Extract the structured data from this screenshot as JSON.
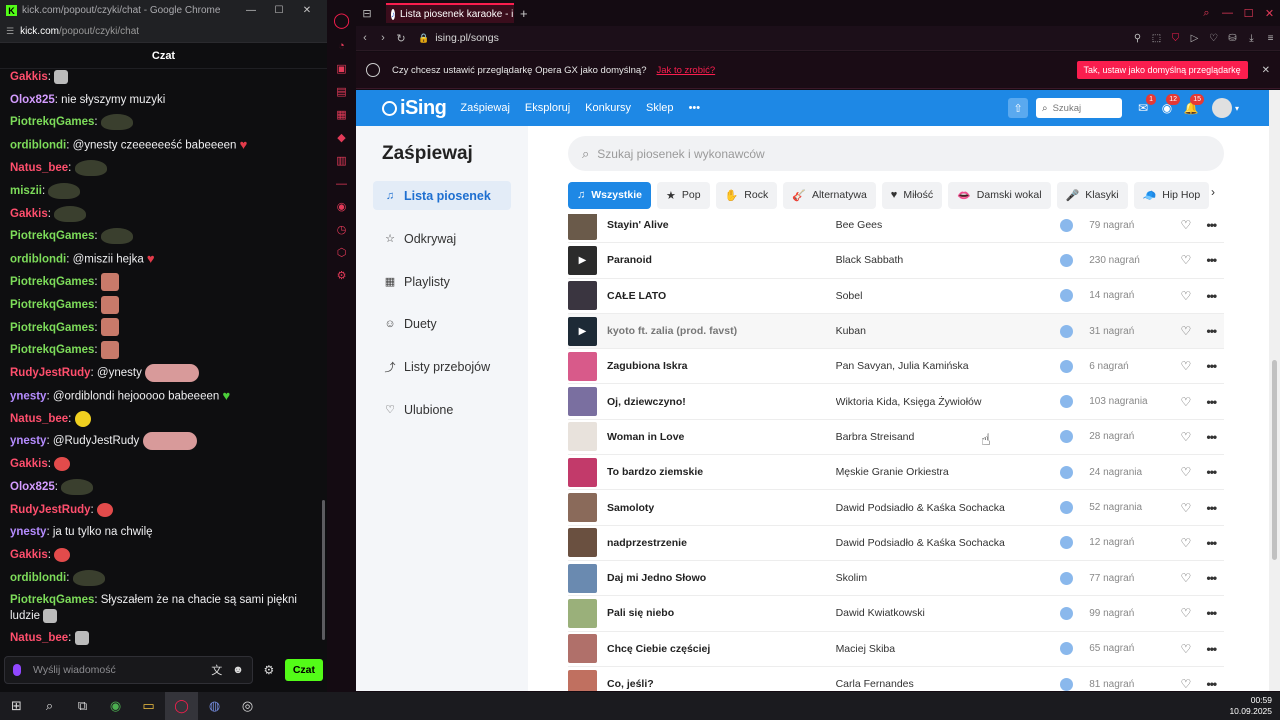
{
  "chat_window": {
    "title": "kick.com/popout/czyki/chat - Google Chrome",
    "url_host": "kick.com",
    "url_path": "/popout/czyki/chat",
    "header": "Czat",
    "input_placeholder": "Wyślij wiadomość",
    "send_label": "Czat",
    "messages": [
      {
        "user": "Gakkis",
        "color": "#ff4f6d",
        "text": "",
        "emote": "small"
      },
      {
        "user": "Olox825",
        "color": "#d49cff",
        "text": "nie słyszymy muzyki",
        "emote": ""
      },
      {
        "user": "PiotrekqGames",
        "color": "#7ddc5a",
        "text": "",
        "emote": "frog"
      },
      {
        "user": "ordiblondi",
        "color": "#7ddc5a",
        "text": "@ynesty czeeeeeeść babeeeen",
        "emote": "heart-red"
      },
      {
        "user": "Natus_bee",
        "color": "#ff4f6d",
        "text": "",
        "emote": "frog"
      },
      {
        "user": "miszii",
        "color": "#7ddc5a",
        "text": "",
        "emote": "frog"
      },
      {
        "user": "Gakkis",
        "color": "#ff4f6d",
        "text": "",
        "emote": "frog"
      },
      {
        "user": "PiotrekqGames",
        "color": "#7ddc5a",
        "text": "",
        "emote": "frog"
      },
      {
        "user": "ordiblondi",
        "color": "#7ddc5a",
        "text": "@miszii hejka",
        "emote": "heart-red"
      },
      {
        "user": "PiotrekqGames",
        "color": "#7ddc5a",
        "text": "",
        "emote": "face"
      },
      {
        "user": "PiotrekqGames",
        "color": "#7ddc5a",
        "text": "",
        "emote": "face"
      },
      {
        "user": "PiotrekqGames",
        "color": "#7ddc5a",
        "text": "",
        "emote": "face"
      },
      {
        "user": "PiotrekqGames",
        "color": "#7ddc5a",
        "text": "",
        "emote": "face"
      },
      {
        "user": "RudyJestRudy",
        "color": "#ff4f6d",
        "text": "@ynesty",
        "emote": "lips"
      },
      {
        "user": "ynesty",
        "color": "#b58cff",
        "text": "@ordiblondi hejooooo babeeeen",
        "emote": "heart-green"
      },
      {
        "user": "Natus_bee",
        "color": "#ff4f6d",
        "text": "",
        "emote": "yellow"
      },
      {
        "user": "ynesty",
        "color": "#b58cff",
        "text": "@RudyJestRudy",
        "emote": "lips"
      },
      {
        "user": "Gakkis",
        "color": "#ff4f6d",
        "text": "",
        "emote": "blob"
      },
      {
        "user": "Olox825",
        "color": "#d49cff",
        "text": "",
        "emote": "frog"
      },
      {
        "user": "RudyJestRudy",
        "color": "#ff4f6d",
        "text": "",
        "emote": "blob"
      },
      {
        "user": "ynesty",
        "color": "#b58cff",
        "text": "ja tu tylko na chwilę",
        "emote": ""
      },
      {
        "user": "Gakkis",
        "color": "#ff4f6d",
        "text": "",
        "emote": "blob"
      },
      {
        "user": "ordiblondi",
        "color": "#7ddc5a",
        "text": "",
        "emote": "frog"
      },
      {
        "user": "PiotrekqGames",
        "color": "#7ddc5a",
        "text": "Słyszałem że na chacie są sami piękni ludzie",
        "emote": "small",
        "wrap": true
      },
      {
        "user": "Natus_bee",
        "color": "#ff4f6d",
        "text": "",
        "emote": "small"
      }
    ]
  },
  "opera": {
    "tab_title": "Lista piosenek karaoke - i",
    "address": "ising.pl/songs",
    "banner_text": "Czy chcesz ustawić przeglądarkę Opera GX jako domyślną?",
    "banner_link": "Jak to zrobić?",
    "banner_button": "Tak, ustaw jako domyślną przeglądarkę"
  },
  "ising": {
    "logo": "iSing",
    "nav": [
      "Zaśpiewaj",
      "Eksploruj",
      "Konkursy",
      "Sklep"
    ],
    "search_placeholder": "Szukaj",
    "badges": {
      "messages": "1",
      "views": "12",
      "notifications": "15"
    },
    "page_title": "Zaśpiewaj",
    "side_items": [
      {
        "label": "Lista piosenek",
        "icon": "music-note-icon",
        "active": true
      },
      {
        "label": "Odkrywaj",
        "icon": "star-icon",
        "active": false
      },
      {
        "label": "Playlisty",
        "icon": "grid-icon",
        "active": false
      },
      {
        "label": "Duety",
        "icon": "users-icon",
        "active": false
      },
      {
        "label": "Listy przebojów",
        "icon": "chart-icon",
        "active": false
      },
      {
        "label": "Ulubione",
        "icon": "heart-icon",
        "active": false
      }
    ],
    "song_search_placeholder": "Szukaj piosenek i wykonawców",
    "genres": [
      {
        "label": "Wszystkie",
        "icon": "♫",
        "active": true
      },
      {
        "label": "Pop",
        "icon": "★"
      },
      {
        "label": "Rock",
        "icon": "✋"
      },
      {
        "label": "Alternatywa",
        "icon": "🎸"
      },
      {
        "label": "Miłość",
        "icon": "♥"
      },
      {
        "label": "Damski wokal",
        "icon": "👄"
      },
      {
        "label": "Klasyki",
        "icon": "🎤"
      },
      {
        "label": "Hip Hop",
        "icon": "🧢"
      }
    ],
    "songs": [
      {
        "title": "Stayin' Alive",
        "artist": "Bee Gees",
        "count": "79 nagrań",
        "thumb": "#6a5a4a"
      },
      {
        "title": "Paranoid",
        "artist": "Black Sabbath",
        "count": "230 nagrań",
        "thumb": "#2b2b2b",
        "play": true
      },
      {
        "title": "CAŁE LATO",
        "artist": "Sobel",
        "count": "14 nagrań",
        "thumb": "#3a3540"
      },
      {
        "title": "kyoto ft. zalia (prod. favst)",
        "artist": "Kuban",
        "count": "31 nagrań",
        "thumb": "#1d2a36",
        "play": true,
        "hover": true
      },
      {
        "title": "Zagubiona Iskra",
        "artist": "Pan Savyan, Julia Kamińska",
        "count": "6 nagrań",
        "thumb": "#d85a8a"
      },
      {
        "title": "Oj, dziewczyno!",
        "artist": "Wiktoria Kida, Księga Żywiołów",
        "count": "103 nagrania",
        "thumb": "#7a6fa0"
      },
      {
        "title": "Woman in Love",
        "artist": "Barbra Streisand",
        "count": "28 nagrań",
        "thumb": "#e8e2dc"
      },
      {
        "title": "To bardzo ziemskie",
        "artist": "Męskie Granie Orkiestra",
        "count": "24 nagrania",
        "thumb": "#c23a6a"
      },
      {
        "title": "Samoloty",
        "artist": "Dawid Podsiadło & Kaśka Sochacka",
        "count": "52 nagrania",
        "thumb": "#8a6a5a"
      },
      {
        "title": "nadprzestrzenie",
        "artist": "Dawid Podsiadło & Kaśka Sochacka",
        "count": "12 nagrań",
        "thumb": "#6a5040"
      },
      {
        "title": "Daj mi Jedno Słowo",
        "artist": "Skolim",
        "count": "77 nagrań",
        "thumb": "#6a8ab0"
      },
      {
        "title": "Pali się niebo",
        "artist": "Dawid Kwiatkowski",
        "count": "99 nagrań",
        "thumb": "#9ab07a"
      },
      {
        "title": "Chcę Ciebie częściej",
        "artist": "Maciej Skiba",
        "count": "65 nagrań",
        "thumb": "#b0706a"
      },
      {
        "title": "Co, jeśli?",
        "artist": "Carla Fernandes",
        "count": "81 nagrań",
        "thumb": "#c07060"
      }
    ]
  },
  "taskbar": {
    "time": "00:59",
    "date": "10.09.2025"
  }
}
